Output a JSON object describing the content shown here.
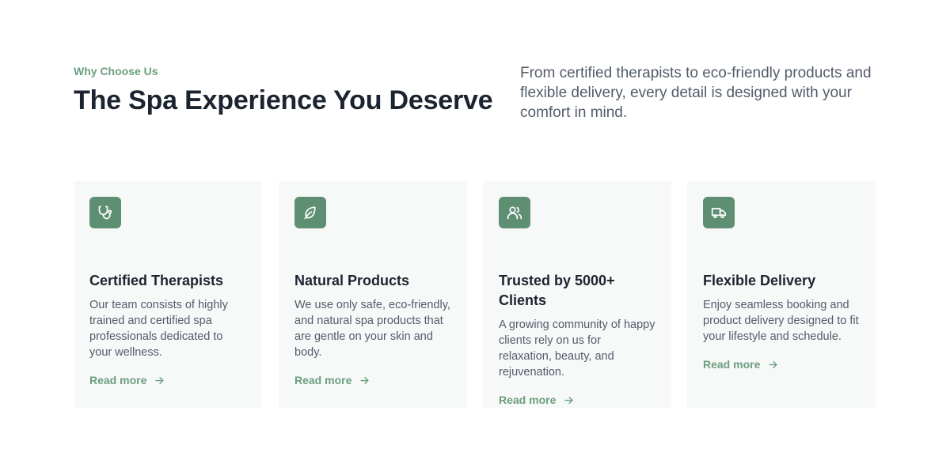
{
  "section": {
    "eyebrow": "Why Choose Us",
    "title": "The Spa Experience You Deserve",
    "intro": "From certified therapists to eco-friendly products and flexible delivery, every detail is designed with your comfort in mind."
  },
  "colors": {
    "accent": "#6b9e7f",
    "icon_bg": "#5e8f73",
    "heading": "#1c2430",
    "body": "#525c6a",
    "card_bg": "#f7f8f8"
  },
  "features": [
    {
      "icon": "stethoscope-icon",
      "title": "Certified Therapists",
      "description": "Our team consists of highly trained and certified spa professionals dedicated to your wellness.",
      "link": "Read more"
    },
    {
      "icon": "leaf-icon",
      "title": "Natural Products",
      "description": "We use only safe, eco-friendly, and natural spa products that are gentle on your skin and body.",
      "link": "Read more"
    },
    {
      "icon": "users-icon",
      "title": "Trusted by 5000+ Clients",
      "description": "A growing community of happy clients rely on us for relaxation, beauty, and rejuvenation.",
      "link": "Read more"
    },
    {
      "icon": "truck-icon",
      "title": "Flexible Delivery",
      "description": "Enjoy seamless booking and product delivery designed to fit your lifestyle and schedule.",
      "link": "Read more"
    }
  ]
}
